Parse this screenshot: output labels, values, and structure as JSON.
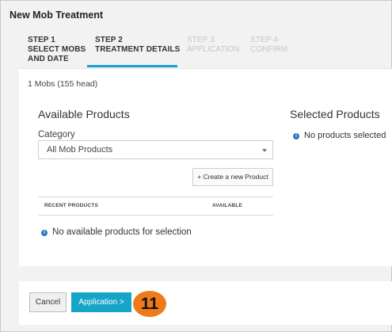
{
  "dialog": {
    "title": "New Mob Treatment"
  },
  "steps": [
    {
      "line1": "STEP 1",
      "line2": "SELECT MOBS",
      "line3": "AND DATE",
      "state": "done"
    },
    {
      "line1": "STEP 2",
      "line2": "TREATMENT DETAILS",
      "state": "active"
    },
    {
      "line1": "STEP 3",
      "line2": "APPLICATION",
      "state": "disabled"
    },
    {
      "line1": "STEP 4",
      "line2": "CONFIRM",
      "state": "disabled"
    }
  ],
  "summary": {
    "mobs_text": "1 Mobs (155 head)"
  },
  "available": {
    "heading": "Available Products",
    "category_label": "Category",
    "category_value": "All Mob Products",
    "new_product_button": "+ Create a new Product",
    "table_headers": {
      "recent": "RECENT PRODUCTS",
      "available": "AVAILABLE"
    },
    "empty_message": "No available products for selection"
  },
  "selected": {
    "heading": "Selected Products",
    "empty_message": "No products selected"
  },
  "footer": {
    "cancel_label": "Cancel",
    "next_label": "Application >",
    "callout_number": "11"
  },
  "colors": {
    "accent": "#1a9fd8",
    "primary_button": "#17a5c7",
    "info_icon": "#2b74c7",
    "callout": "#ef7a1a"
  },
  "icons": {
    "info": "info-icon",
    "dropdown": "chevron-down-icon"
  }
}
